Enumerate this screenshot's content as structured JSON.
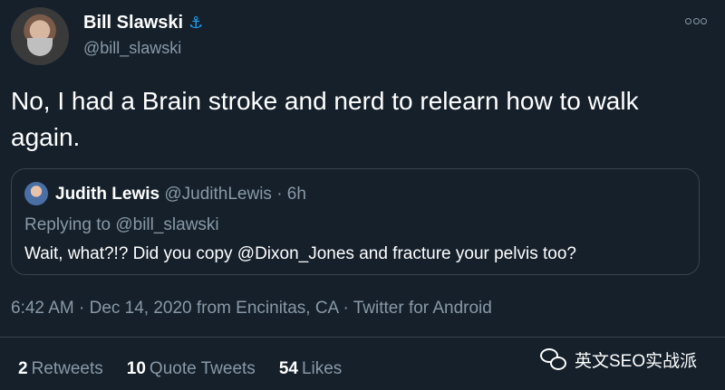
{
  "author": {
    "display_name": "Bill Slawski",
    "badge_icon": "anchor-icon",
    "handle": "@bill_slawski"
  },
  "tweet": {
    "text": "No, I had a Brain stroke and nerd to relearn how to walk again."
  },
  "quoted_tweet": {
    "author_name": "Judith Lewis",
    "handle_time": "@JudithLewis · 6h",
    "replying_to": "Replying to @bill_slawski",
    "text": "Wait, what?!? Did you copy @Dixon_Jones and fracture your pelvis too?"
  },
  "meta": {
    "timestamp": "6:42 AM · Dec 14, 2020 from Encinitas, CA · Twitter for Android"
  },
  "stats": {
    "retweets_count": "2",
    "retweets_label": "Retweets",
    "quotes_count": "10",
    "quotes_label": "Quote Tweets",
    "likes_count": "54",
    "likes_label": "Likes"
  },
  "watermark": {
    "text": "英文SEO实战派"
  },
  "colors": {
    "background": "#15202b",
    "muted": "#8899a6",
    "border": "#38444d",
    "accent": "#1da1f2"
  }
}
